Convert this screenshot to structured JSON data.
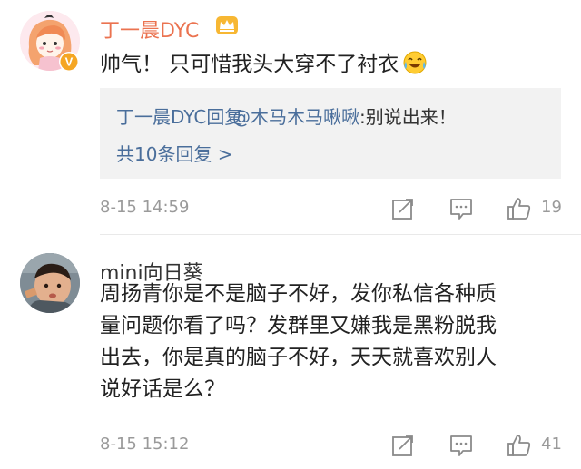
{
  "comments": [
    {
      "author": "丁一晨DYC",
      "text": "帅气！ 只可惜我头大穿不了衬衣",
      "reply": {
        "author": "丁一晨DYC回复",
        "mention": "@木马木马啾啾",
        "text": ":别说出来！",
        "more": "共10条回复 >"
      },
      "time": "8-15 14:59",
      "likes": "19",
      "icons": [
        "avatar",
        "verified-badge-icon",
        "crown-icon",
        "laugh-cry-emoji-icon",
        "share-icon",
        "comment-icon",
        "thumbs-up-icon"
      ]
    },
    {
      "author": "mini向日葵",
      "text_lines": [
        "周扬青你是不是脑子不好，发你私信各种质",
        "量问题你看了吗？发群里又嫌我是黑粉脱我",
        "出去，你是真的脑子不好，天天就喜欢别人",
        "说好话是么？"
      ],
      "time": "8-15 15:12",
      "likes": "41",
      "icons": [
        "avatar",
        "share-icon",
        "comment-icon",
        "thumbs-up-icon"
      ]
    }
  ],
  "colors": {
    "verified_author": "#eb7350",
    "link_blue": "#4a6e9b",
    "meta_gray": "#9a9a9a",
    "reply_bg": "#f2f2f2"
  }
}
